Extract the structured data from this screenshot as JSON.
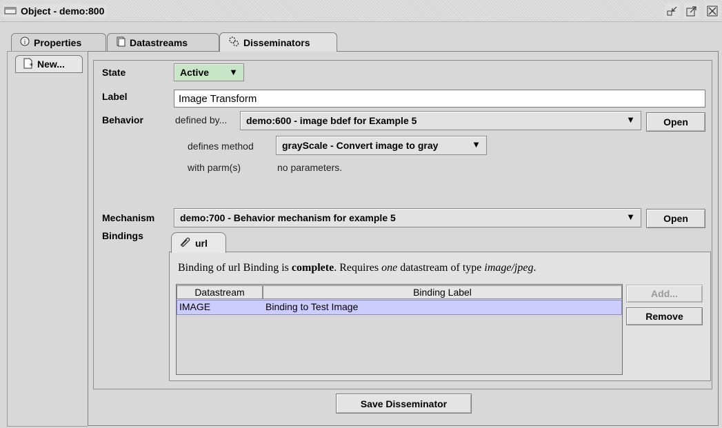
{
  "window": {
    "title": "Object - demo:800",
    "buttons": [
      "minimize-icon",
      "maximize-icon",
      "close-icon"
    ]
  },
  "tabs": [
    {
      "label": "Properties",
      "icon": "info-icon",
      "selected": false
    },
    {
      "label": "Datastreams",
      "icon": "document-icon",
      "selected": false
    },
    {
      "label": "Disseminators",
      "icon": "gears-icon",
      "selected": true
    }
  ],
  "left": {
    "new_label": "New..."
  },
  "form": {
    "state_label": "State",
    "state_value": "Active",
    "state_color": "#c6e6c6",
    "label_label": "Label",
    "label_value": "Image Transform",
    "behavior_label": "Behavior",
    "defined_by": "defined by...",
    "behavior_value": "demo:600 - image bdef for Example 5",
    "open_label": "Open",
    "defines_method": "defines method",
    "method_value": "grayScale - Convert image to gray",
    "with_parms": "with parm(s)",
    "no_parms": "no parameters.",
    "mechanism_label": "Mechanism",
    "mechanism_value": "demo:700 - Behavior mechanism for example 5",
    "mech_open_label": "Open",
    "bindings_label": "Bindings"
  },
  "bindings": {
    "tab_label": "url",
    "desc_prefix": "Binding of url Binding is ",
    "desc_status": "complete",
    "desc_mid": ". Requires ",
    "desc_count": "one",
    "desc_mid2": " datastream of type ",
    "desc_type": "image/jpeg",
    "desc_end": ".",
    "columns": [
      "Datastream",
      "Binding Label"
    ],
    "rows": [
      {
        "datastream": "IMAGE",
        "label": "Binding to Test Image"
      }
    ],
    "add_label": "Add...",
    "remove_label": "Remove",
    "selected_row_color": "#ccccff"
  },
  "save_label": "Save Disseminator"
}
